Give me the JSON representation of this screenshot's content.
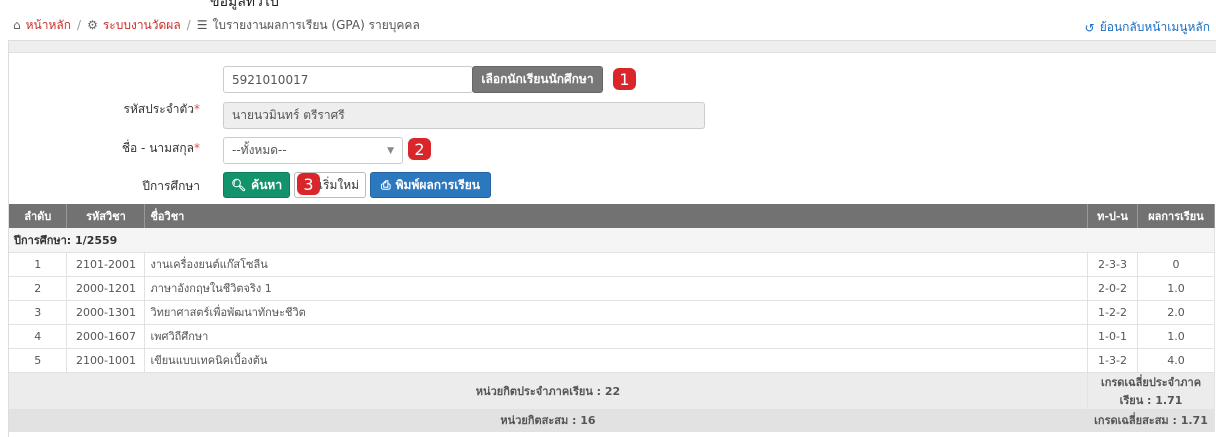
{
  "top_cut_text": "ข้อมูลทั่วไป",
  "breadcrumb": {
    "home": "หน้าหลัก",
    "system": "ระบบงานวัดผล",
    "current": "ใบรายงานผลการเรียน (GPA) รายบุคคล",
    "back": "ย้อนกลับหน้าเมนูหลัก"
  },
  "form": {
    "student_id_label": "รหัสประจำตัว",
    "student_id_value": "5921010017",
    "select_student_button": "เลือกนักเรียนนักศึกษา",
    "name_label": "ชื่อ - นามสกุล",
    "name_value": "นายนวมินทร์ ตรีราศรี",
    "year_label": "ปีการศึกษา",
    "year_value": "--ทั้งหมด--",
    "search_button": "ค้นหา",
    "reset_button": "เริ่มใหม่",
    "print_button": "พิมพ์ผลการเรียน"
  },
  "badges": [
    "1",
    "2",
    "3"
  ],
  "table": {
    "headers": [
      "ลำดับ",
      "รหัสวิชา",
      "ชื่อวิชา",
      "ท-ป-น",
      "ผลการเรียน"
    ],
    "term_label": "ปีการศึกษา: 1/2559",
    "rows": [
      {
        "no": "1",
        "code": "2101-2001",
        "name": "งานเครื่องยนต์แก๊สโซลีน",
        "credit": "2-3-3",
        "grade": "0"
      },
      {
        "no": "2",
        "code": "2000-1201",
        "name": "ภาษาอังกฤษในชีวิตจริง 1",
        "credit": "2-0-2",
        "grade": "1.0"
      },
      {
        "no": "3",
        "code": "2000-1301",
        "name": "วิทยาศาสตร์เพื่อพัฒนาทักษะชีวิต",
        "credit": "1-2-2",
        "grade": "2.0"
      },
      {
        "no": "4",
        "code": "2000-1607",
        "name": "เพศวิถีศึกษา",
        "credit": "1-0-1",
        "grade": "1.0"
      },
      {
        "no": "5",
        "code": "2100-1001",
        "name": "เขียนแบบเทคนิคเบื้องต้น",
        "credit": "1-3-2",
        "grade": "4.0"
      }
    ],
    "term_credits": "หน่วยกิตประจำภาคเรียน : 22",
    "term_gpa": "เกรดเฉลี่ยประจำภาคเรียน : 1.71",
    "cum_credits": "หน่วยกิตสะสม : 16",
    "cum_gpa": "เกรดเฉลี่ยสะสม : 1.71"
  },
  "colors": {
    "accent_red": "#d9262a",
    "green": "#13936c",
    "blue": "#2c78bf",
    "header_gray": "#727272"
  }
}
